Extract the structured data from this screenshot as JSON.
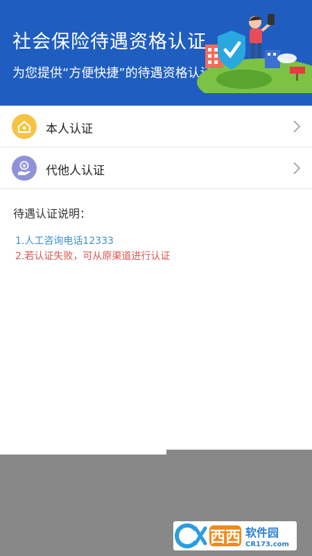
{
  "header": {
    "title": "社会保险待遇资格认证",
    "subtitle": "为您提供“方便快捷”的待遇资格认证"
  },
  "menu": [
    {
      "label": "本人认证",
      "icon": "home-icon",
      "icon_color": "#f6c343"
    },
    {
      "label": "代他人认证",
      "icon": "hand-yuan-icon",
      "icon_color": "#8f92d9"
    }
  ],
  "notes": {
    "title": "待遇认证说明：",
    "items": [
      {
        "text": "1.人工咨询电话12333",
        "color": "#3a8fd6"
      },
      {
        "text": "2.若认证失败，可从原渠道进行认证",
        "color": "#d9534f"
      }
    ]
  },
  "watermark": {
    "brand": "西西",
    "brand2": "软件园",
    "site": "CR173.com"
  },
  "colors": {
    "header_bg": "#1f5ec0",
    "overlay": "#888888"
  }
}
